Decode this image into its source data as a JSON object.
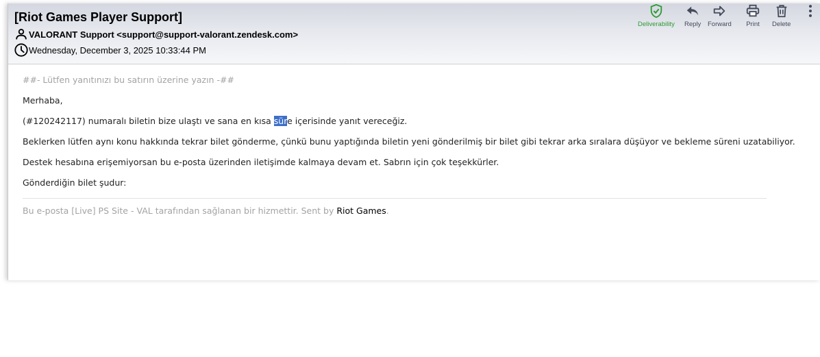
{
  "email": {
    "subject": "[Riot Games Player Support]",
    "from": "VALORANT Support <support@support-valorant.zendesk.com>",
    "date": "Wednesday, December 3, 2025 10:33:44 PM"
  },
  "toolbar": {
    "deliverability": "Deliverability",
    "reply": "Reply",
    "forward": "Forward",
    "print": "Print",
    "delete": "Delete"
  },
  "colors": {
    "deliverability_green": "#2e9a34",
    "highlight_blue": "#3d6fc9",
    "header_gradient_top": "#d4d7e0"
  },
  "body": {
    "reply_line": "##- Lütfen yanıtınızı bu satırın üzerine yazın -##",
    "greeting": "Merhaba,",
    "line1_before": "(#120242117) numaralı biletin bize ulaştı ve sana en kısa ",
    "line1_highlight": "sür",
    "line1_after": "e içerisinde yanıt vereceğiz.",
    "line2": "Beklerken lütfen aynı konu hakkında tekrar bilet gönderme, çünkü bunu yaptığında biletin yeni gönderilmiş bir bilet gibi tekrar arka sıralara düşüyor ve bekleme süreni uzatabiliyor.",
    "line3": "Destek hesabına erişemiyorsan bu e-posta üzerinden iletişimde kalmaya devam et. Sabrın için çok teşekkürler.",
    "line4": "Gönderdiğin bilet şudur:",
    "footer_before": "Bu e-posta [Live] PS Site - VAL tarafından sağlanan bir hizmettir. Sent by ",
    "footer_link": "Riot Games",
    "footer_after": "."
  }
}
